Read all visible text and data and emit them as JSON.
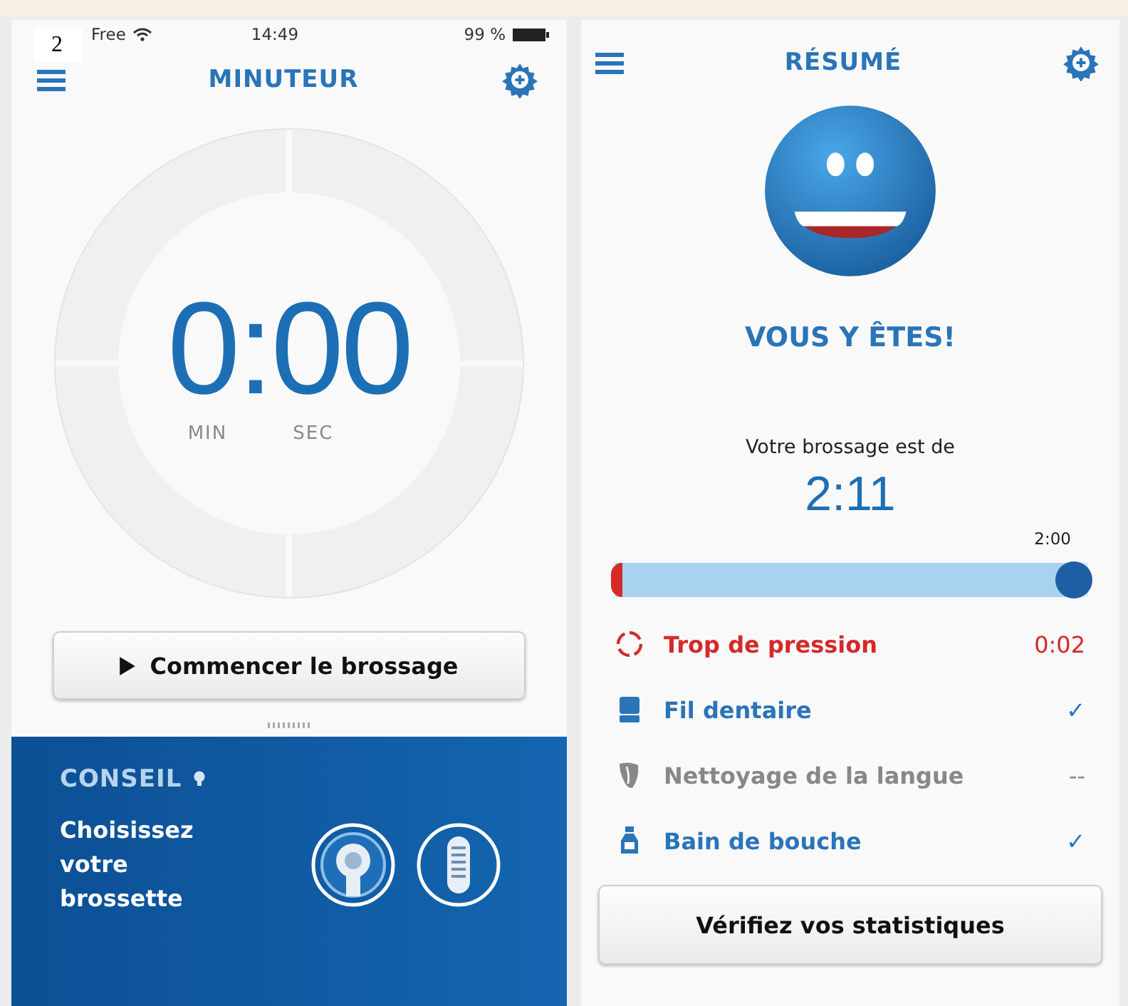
{
  "figure_label": "2",
  "timer_screen": {
    "status_bar": {
      "carrier": "Free",
      "time": "14:49",
      "battery": "99 %"
    },
    "title": "MINUTEUR",
    "timer": {
      "value": "0:00",
      "units": [
        "MIN",
        "SEC"
      ]
    },
    "start_button": "Commencer le brossage",
    "tip": {
      "heading": "CONSEIL",
      "text": "Choisissez votre brossette"
    }
  },
  "summary_screen": {
    "title": "RÉSUMÉ",
    "headline": "VOUS Y ÊTES!",
    "duration_label": "Votre brossage est de",
    "duration": "2:11",
    "progress": {
      "marker_label": "2:00",
      "level": 0.97
    },
    "items": [
      {
        "kind": "pressure",
        "label": "Trop de pression",
        "value": "0:02"
      },
      {
        "kind": "floss",
        "label": "Fil dentaire",
        "value": "✓",
        "done": true
      },
      {
        "kind": "tongue",
        "label": "Nettoyage de la langue",
        "value": "--",
        "done": false
      },
      {
        "kind": "mouthwash",
        "label": "Bain de bouche",
        "value": "✓",
        "done": true
      }
    ],
    "stats_button": "Vérifiez vos statistiques"
  }
}
